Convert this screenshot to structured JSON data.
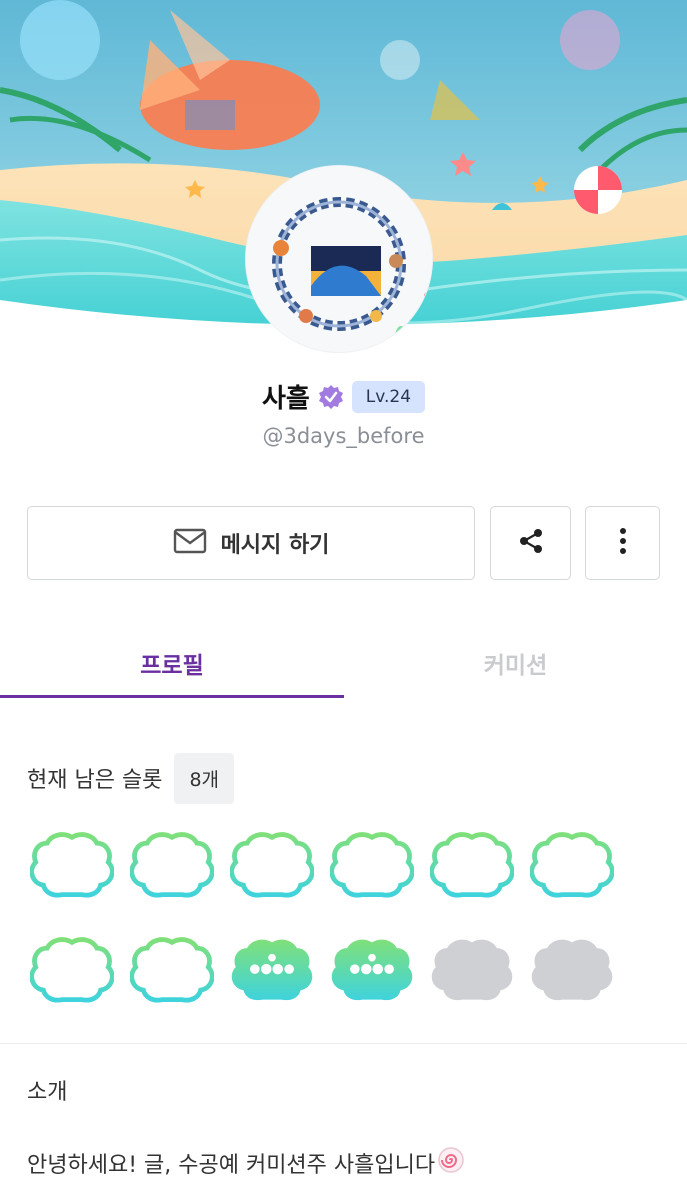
{
  "profile": {
    "name": "사흘",
    "level": "Lv.24",
    "handle": "@3days_before"
  },
  "actions": {
    "message_label": "메시지 하기"
  },
  "tabs": [
    {
      "label": "프로필",
      "active": true
    },
    {
      "label": "커미션",
      "active": false
    }
  ],
  "slots": {
    "title": "현재 남은 슬롯",
    "count": "8개",
    "items": [
      "empty",
      "empty",
      "empty",
      "empty",
      "empty",
      "empty",
      "empty",
      "empty",
      "filled",
      "filled",
      "locked",
      "locked"
    ]
  },
  "intro": {
    "title": "소개",
    "text": "안녕하세요! 글, 수공예 커미션주 사흘입니다"
  },
  "colors": {
    "accent": "#6a2fa0",
    "level_badge": "#d6e3ff",
    "slot_gradient_top": "#7fe07a",
    "slot_gradient_bottom": "#3fd3dd",
    "slot_locked": "#cfd0d4"
  },
  "icons": {
    "verified": "verified-badge-icon",
    "message": "envelope-icon",
    "share": "share-icon",
    "more": "more-vertical-icon",
    "emoji": "narutomaki-icon"
  }
}
